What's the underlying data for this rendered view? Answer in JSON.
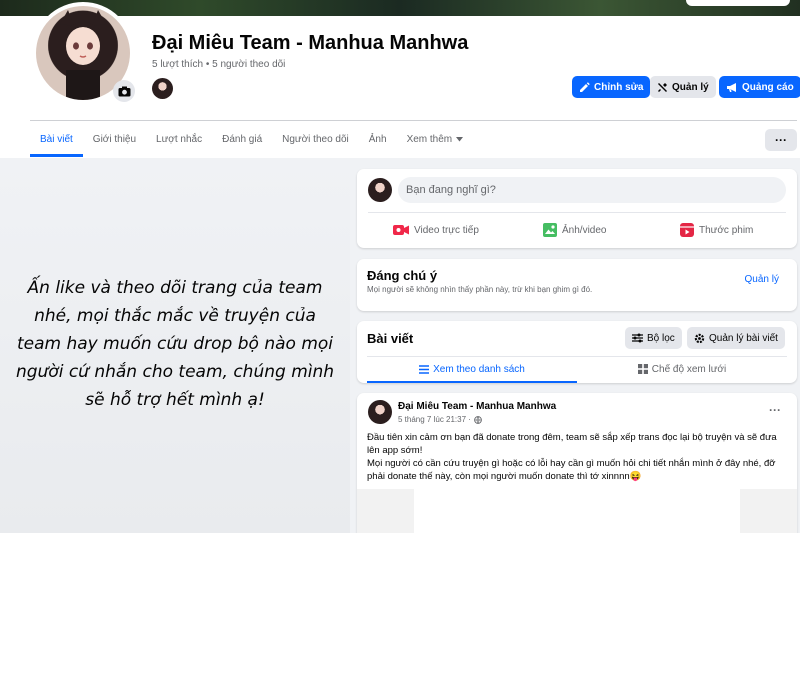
{
  "page": {
    "title": "Đại Miêu Team - Manhua Manhwa",
    "stats": "5 lượt thích • 5 người theo dõi"
  },
  "header_buttons": {
    "edit": "Chỉnh sửa",
    "manage": "Quản lý",
    "ads": "Quảng cáo"
  },
  "tabs": [
    {
      "label": "Bài viết"
    },
    {
      "label": "Giới thiệu"
    },
    {
      "label": "Lượt nhắc"
    },
    {
      "label": "Đánh giá"
    },
    {
      "label": "Người theo dõi"
    },
    {
      "label": "Ảnh"
    },
    {
      "label": "Xem thêm"
    }
  ],
  "promo_text": "Ấn like và theo dõi trang của team nhé, mọi thắc mắc về truyện của team hay muốn cứu drop bộ nào mọi người cứ nhắn cho team, chúng mình sẽ hỗ trợ hết mình ạ!",
  "composer": {
    "placeholder": "Bạn đang nghĩ gì?",
    "actions": {
      "live": "Video trực tiếp",
      "photo": "Ảnh/video",
      "reel": "Thước phim"
    }
  },
  "featured": {
    "title": "Đáng chú ý",
    "subtitle": "Mọi người sẽ không nhìn thấy phần này, trừ khi bạn ghim gì đó.",
    "manage": "Quản lý"
  },
  "posts_header": {
    "title": "Bài viết",
    "filter": "Bộ lọc",
    "manage": "Quản lý bài viết",
    "list_view": "Xem theo danh sách",
    "grid_view": "Chế độ xem lưới"
  },
  "post": {
    "author": "Đại Miêu Team - Manhua Manhwa",
    "time": "5 tháng 7 lúc 21:37 ·",
    "line1": "Đầu tiên xin cảm ơn bạn đã donate trong đêm, team sẽ sắp xếp trans đọc lại bộ truyện và sẽ đưa lên app sớm!",
    "line2": "Mọi người có cần cứu truyện gì hoặc có lỗi hay cần gì muốn hỏi chi tiết nhắn mình ở đây nhé, đỡ phải donate thế này, còn mọi người muốn donate thì tớ xinnnn😝"
  },
  "colors": {
    "accent": "#0866ff",
    "background": "#f0f2f5",
    "secondary_text": "#65676b",
    "live_icon": "#f02849",
    "photo_icon": "#45bd62",
    "reel_icon": "#e42645"
  }
}
